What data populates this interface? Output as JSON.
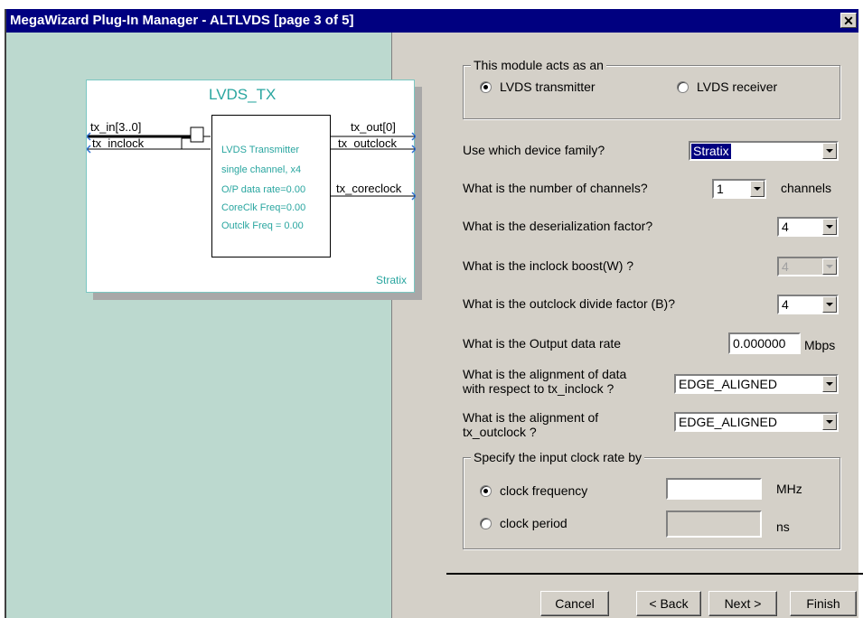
{
  "window": {
    "title": "MegaWizard Plug-In Manager - ALTLVDS [page 3 of 5]",
    "close_glyph": "✕"
  },
  "symbol": {
    "name": "LVDS_TX",
    "inputs": [
      "tx_in[3..0]",
      "tx_inclock"
    ],
    "outputs": [
      "tx_out[0]",
      "tx_outclock",
      "tx_coreclock"
    ],
    "info": [
      "LVDS Transmitter",
      "single channel, x4",
      "O/P data rate=0.00",
      "CoreClk Freq=0.00",
      "Outclk Freq = 0.00"
    ],
    "family": "Stratix"
  },
  "module_group": {
    "caption": "This module acts as an",
    "opt_tx": "LVDS transmitter",
    "opt_rx": "LVDS receiver",
    "selected": "transmitter"
  },
  "questions": {
    "family_label": "Use which device family?",
    "family_value": "Stratix",
    "channels_label": "What is the number of channels?",
    "channels_value": "1",
    "channels_unit": "channels",
    "deser_label": "What is the deserialization factor?",
    "deser_value": "4",
    "boost_label": "What is the inclock boost(W) ?",
    "boost_value": "4",
    "outdiv_label": "What is the outclock divide factor (B)?",
    "outdiv_value": "4",
    "rate_label": "What is the Output data rate",
    "rate_value": "0.000000",
    "rate_unit": "Mbps",
    "align_data_l1": "What is the alignment of data",
    "align_data_l2": "with respect to tx_inclock ?",
    "align_data_value": "EDGE_ALIGNED",
    "align_out_l1": "What is the alignment of",
    "align_out_l2": "tx_outclock ?",
    "align_out_value": "EDGE_ALIGNED"
  },
  "clock_group": {
    "caption": "Specify the input clock rate by",
    "opt_freq": "clock frequency",
    "opt_period": "clock period",
    "freq_value": "",
    "freq_unit": "MHz",
    "period_value": "",
    "period_unit": "ns",
    "selected": "frequency"
  },
  "buttons": {
    "cancel": "Cancel",
    "back": "< Back",
    "next": "Next >",
    "finish": "Finish"
  }
}
